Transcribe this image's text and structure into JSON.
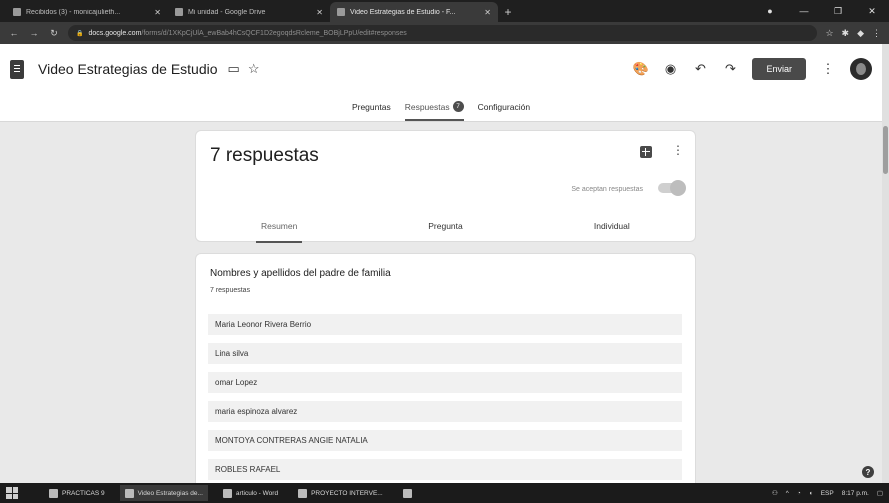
{
  "browser": {
    "tabs": [
      {
        "title": "Recibidos (3) - monicajulieth...",
        "active": false
      },
      {
        "title": "Mi unidad - Google Drive",
        "active": false
      },
      {
        "title": "Video Estrategias de Estudio - F...",
        "active": true
      }
    ],
    "new_tab": "+",
    "url_host": "docs.google.com",
    "url_path": "/forms/d/1XKpCjUlA_ewBab4hCsQCF1D2egoqdsRcleme_BOBjLPpU/edit#responses"
  },
  "app": {
    "doc_title": "Video Estrategias de Estudio",
    "send_label": "Enviar",
    "tabs": {
      "questions": "Preguntas",
      "responses": "Respuestas",
      "responses_badge": "7",
      "settings": "Configuración"
    }
  },
  "summary": {
    "count_label": "7 respuestas",
    "accepting_label": "Se aceptan respuestas",
    "subtabs": {
      "summary": "Resumen",
      "question": "Pregunta",
      "individual": "Individual"
    }
  },
  "question": {
    "title": "Nombres y apellidos del padre de familia",
    "count": "7 respuestas",
    "answers": [
      "Maria Leonor Rivera Berrio",
      "Lina silva",
      "omar Lopez",
      "maria espinoza alvarez",
      "MONTOYA CONTRERAS ANGIE NATALIA",
      "ROBLES RAFAEL"
    ]
  },
  "taskbar": {
    "items": [
      {
        "label": "PRACTICAS 9",
        "active": false
      },
      {
        "label": "Video Estrategias de...",
        "active": true
      },
      {
        "label": "articulo - Word",
        "active": false
      },
      {
        "label": "PROYECTO INTERVE...",
        "active": false
      }
    ],
    "lang": "ESP",
    "time": "8:17 p.m."
  }
}
